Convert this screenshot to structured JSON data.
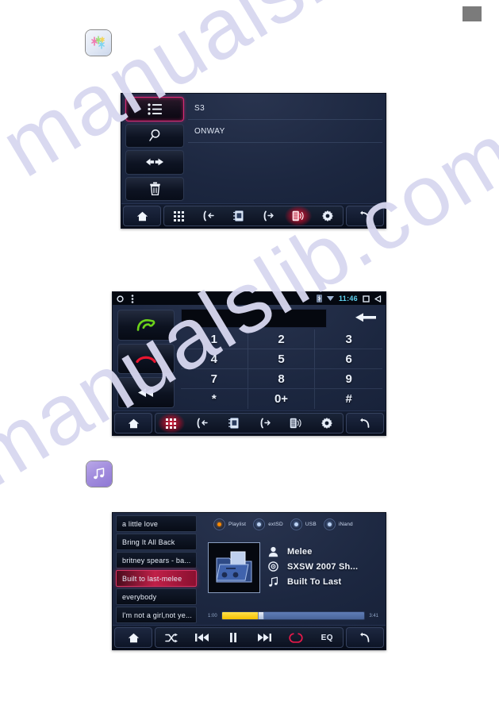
{
  "page": {
    "watermark_text": "manualslib.com",
    "gray_marker": "gray-rectangle"
  },
  "icons": {
    "bluetooth_app": "bluetooth-app-icon",
    "music_app": "music-note-app-icon"
  },
  "bluetooth_panel": {
    "name": "bluetooth-device-screen",
    "side_buttons": [
      {
        "icon": "list-icon",
        "label": "Paired list",
        "selected": true
      },
      {
        "icon": "search-icon",
        "label": "Search",
        "selected": false
      },
      {
        "icon": "transfer-icon",
        "label": "Connect",
        "selected": false
      },
      {
        "icon": "trash-icon",
        "label": "Delete",
        "selected": false
      }
    ],
    "devices": [
      {
        "name": "S3"
      },
      {
        "name": "ONWAY"
      }
    ],
    "navbar": {
      "home": "home-icon",
      "items": [
        {
          "icon": "keypad-icon",
          "name": "dialpad",
          "active": false
        },
        {
          "icon": "call-in-icon",
          "name": "incoming-calls",
          "active": false
        },
        {
          "icon": "contacts-icon",
          "name": "contacts",
          "active": false
        },
        {
          "icon": "call-out-icon",
          "name": "outgoing-calls",
          "active": false
        },
        {
          "icon": "device-icon",
          "name": "devices",
          "active": true
        },
        {
          "icon": "gear-icon",
          "name": "settings",
          "active": false
        }
      ],
      "back": "back-arrow-icon"
    }
  },
  "dialer_panel": {
    "name": "phone-dialer-screen",
    "statusbar": {
      "recents": "circle-icon",
      "menu": "more-vert-icon",
      "bluetooth": "bluetooth-status-icon",
      "signal": "signal-icon",
      "clock": "11:46",
      "square": "square-icon",
      "back": "triangle-back-icon"
    },
    "side_buttons": [
      {
        "icon": "call-answer-icon",
        "label": "Dial",
        "color": "#6cd21a"
      },
      {
        "icon": "call-end-icon",
        "label": "Hang up",
        "color": "#e8152f"
      },
      {
        "icon": "rewind-icon",
        "label": "Backspace",
        "color": "#ffffff"
      }
    ],
    "number_input": {
      "value": "",
      "placeholder": ""
    },
    "backspace": "backspace-arrow-icon",
    "keys": [
      "1",
      "2",
      "3",
      "4",
      "5",
      "6",
      "7",
      "8",
      "9",
      "*",
      "0+",
      "#"
    ],
    "navbar": {
      "home": "home-icon",
      "items": [
        {
          "icon": "keypad-icon",
          "name": "dialpad",
          "active": true
        },
        {
          "icon": "call-in-icon",
          "name": "incoming-calls",
          "active": false
        },
        {
          "icon": "contacts-icon",
          "name": "contacts",
          "active": false
        },
        {
          "icon": "call-out-icon",
          "name": "outgoing-calls",
          "active": false
        },
        {
          "icon": "device-icon",
          "name": "devices",
          "active": false
        },
        {
          "icon": "gear-icon",
          "name": "settings",
          "active": false
        }
      ],
      "back": "back-arrow-icon"
    }
  },
  "music_panel": {
    "name": "music-player-screen",
    "playlist": [
      {
        "title": "a little love",
        "selected": false
      },
      {
        "title": "Bring It All Back",
        "selected": false
      },
      {
        "title": "britney spears - ba...",
        "selected": false
      },
      {
        "title": "Built to last-melee",
        "selected": true
      },
      {
        "title": "everybody",
        "selected": false
      },
      {
        "title": "I'm not a girl,not ye...",
        "selected": false
      }
    ],
    "sources": [
      {
        "label": "Playlist",
        "selected": true
      },
      {
        "label": "extSD",
        "selected": false
      },
      {
        "label": "USB",
        "selected": false
      },
      {
        "label": "iNand",
        "selected": false
      }
    ],
    "album_art": "folder-album-art-icon",
    "track_info": [
      {
        "icon": "artist-icon",
        "value": "Melee"
      },
      {
        "icon": "album-icon",
        "value": "SXSW 2007 Sh..."
      },
      {
        "icon": "track-icon",
        "value": "Built To Last"
      }
    ],
    "progress": {
      "elapsed": "1:00",
      "total": "3:41",
      "percent": 27
    },
    "navbar": {
      "home": "home-icon",
      "items": [
        {
          "icon": "shuffle-icon",
          "name": "shuffle",
          "active": false
        },
        {
          "icon": "previous-icon",
          "name": "previous-track",
          "active": false
        },
        {
          "icon": "pause-icon",
          "name": "pause",
          "active": false
        },
        {
          "icon": "next-icon",
          "name": "next-track",
          "active": false
        },
        {
          "icon": "repeat-icon",
          "name": "repeat",
          "active": false
        },
        {
          "icon": "eq-label",
          "name": "equalizer",
          "active": false,
          "label": "EQ"
        }
      ],
      "back": "back-arrow-icon"
    }
  }
}
